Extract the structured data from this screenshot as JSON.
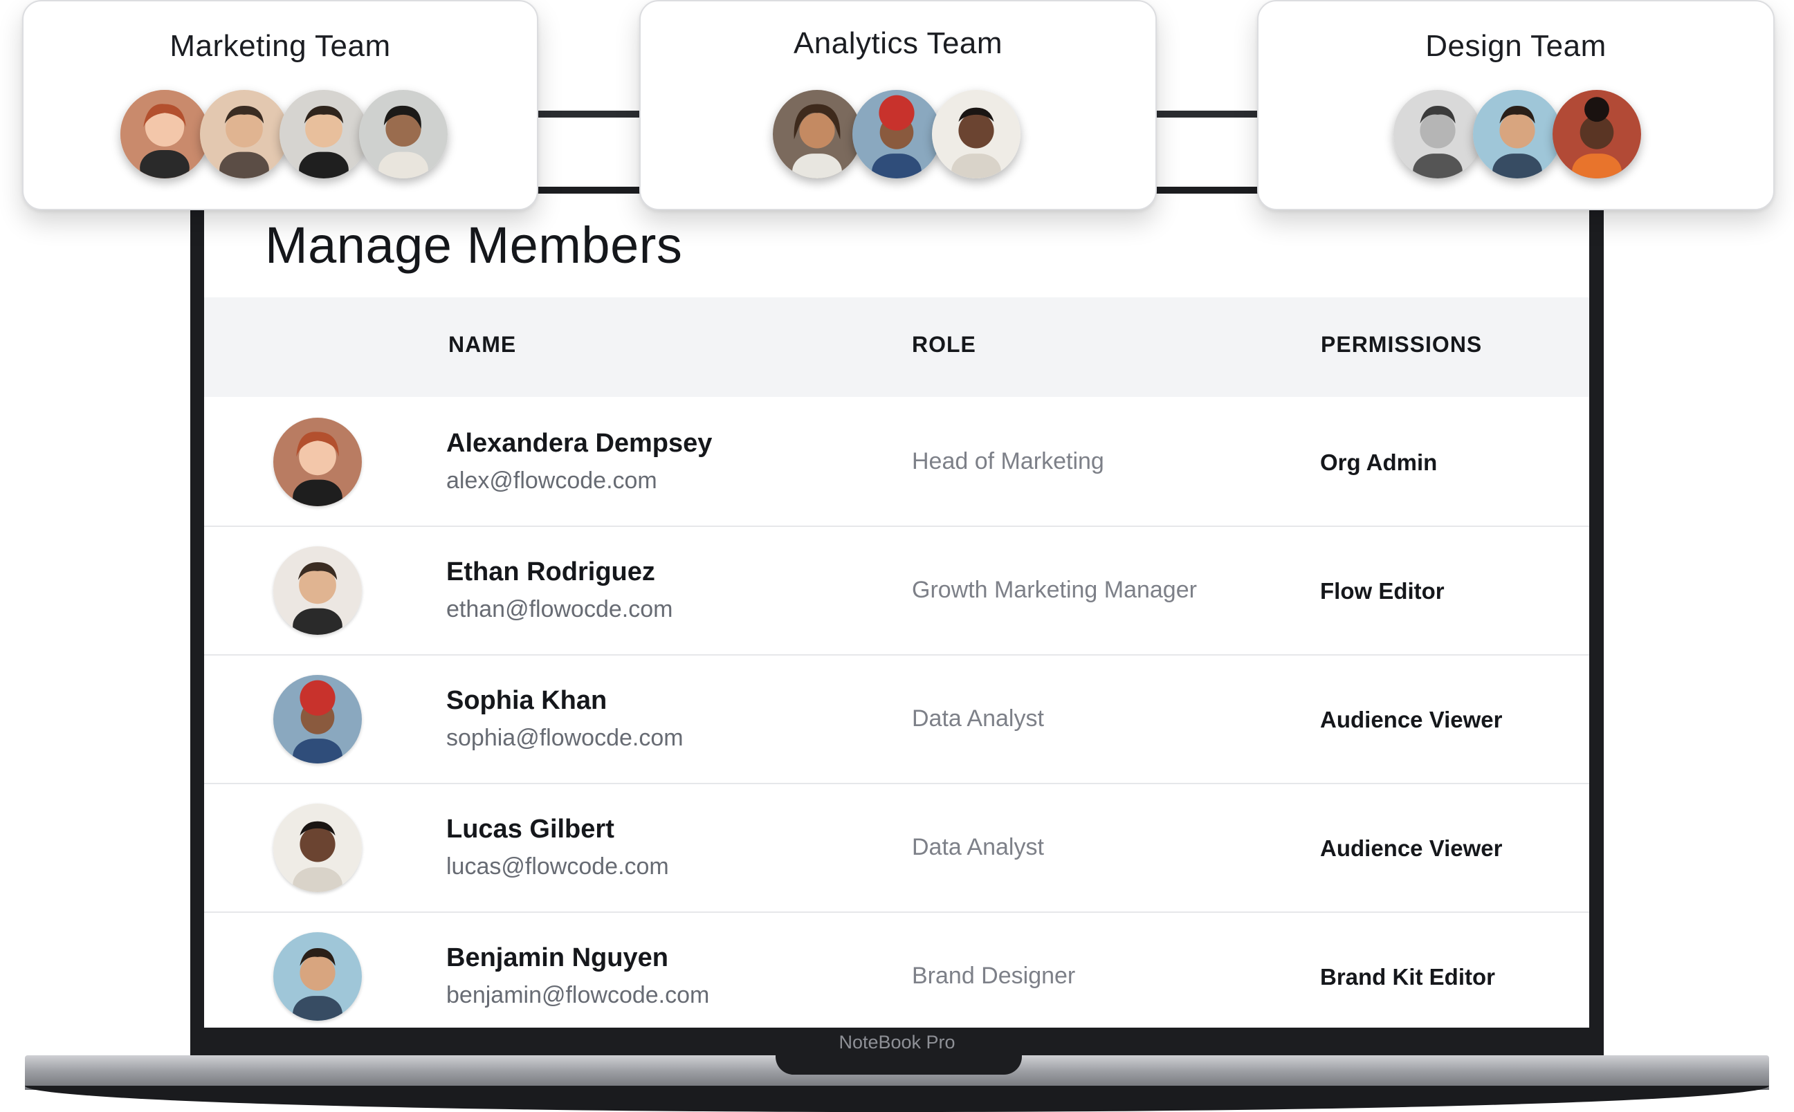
{
  "teams": [
    {
      "name": "Marketing Team",
      "members": 4
    },
    {
      "name": "Analytics Team",
      "members": 3
    },
    {
      "name": "Design Team",
      "members": 3
    }
  ],
  "page": {
    "title": "Manage Members"
  },
  "table": {
    "headers": {
      "name": "NAME",
      "role": "ROLE",
      "permissions": "PERMISSIONS"
    },
    "rows": [
      {
        "name": "Alexandera Dempsey",
        "email": "alex@flowcode.com",
        "role": "Head of Marketing",
        "permission": "Org Admin"
      },
      {
        "name": "Ethan Rodriguez",
        "email": "ethan@flowocde.com",
        "role": "Growth Marketing Manager",
        "permission": "Flow Editor"
      },
      {
        "name": "Sophia Khan",
        "email": "sophia@flowocde.com",
        "role": "Data Analyst",
        "permission": "Audience Viewer"
      },
      {
        "name": "Lucas Gilbert",
        "email": "lucas@flowcode.com",
        "role": "Data Analyst",
        "permission": "Audience Viewer"
      },
      {
        "name": "Benjamin Nguyen",
        "email": "benjamin@flowcode.com",
        "role": "Brand Designer",
        "permission": "Brand Kit Editor"
      }
    ]
  },
  "device": {
    "label": "NoteBook Pro"
  },
  "icons": {
    "avatar": "person-avatar-icon"
  },
  "colors": {
    "text": "#15171b",
    "muted": "#7d8088",
    "header_bg": "#f3f4f6",
    "bezel": "#1c1d20"
  }
}
